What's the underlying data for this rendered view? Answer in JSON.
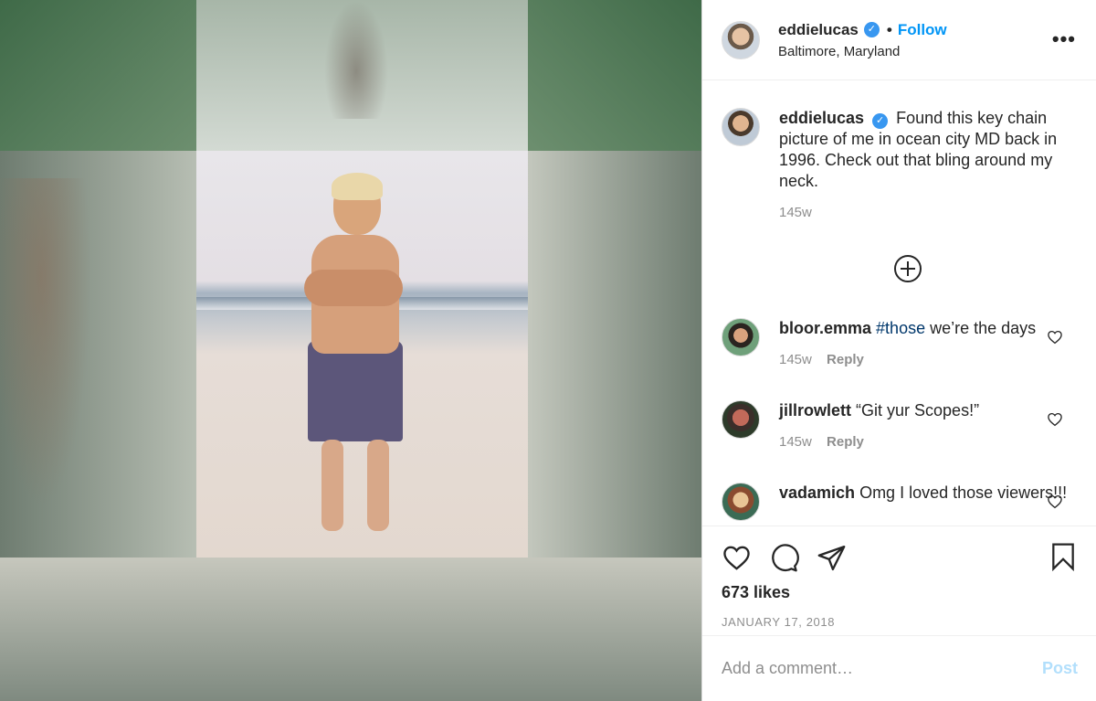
{
  "post": {
    "username": "eddielucas",
    "verified_icon": "verified-badge-icon",
    "separator": "•",
    "follow_label": "Follow",
    "location": "Baltimore, Maryland",
    "more_icon": "more-options-icon",
    "more_label": "•••"
  },
  "caption": {
    "username": "eddielucas",
    "text": "Found this key chain picture of me in ocean city MD back in 1996. Check out that bling around my neck.",
    "time": "145w"
  },
  "load_more_icon": "plus-circle-icon",
  "comments": [
    {
      "username": "bloor.emma",
      "hashtag": "#those",
      "text": " we’re the days",
      "time": "145w",
      "reply_label": "Reply"
    },
    {
      "username": "jillrowlett",
      "text": "“Git yur Scopes!”",
      "time": "145w",
      "reply_label": "Reply"
    },
    {
      "username": "vadamich",
      "text": "Omg I loved those viewers!!!",
      "time": "",
      "reply_label": ""
    }
  ],
  "actions": {
    "like_icon": "heart-icon",
    "comment_icon": "comment-icon",
    "share_icon": "share-icon",
    "save_icon": "bookmark-icon",
    "likes": "673 likes",
    "date": "JANUARY 17, 2018"
  },
  "add_comment": {
    "placeholder": "Add a comment…",
    "post_label": "Post"
  },
  "colors": {
    "accent": "#0095f6",
    "post_disabled": "#b2dffc",
    "verified": "#3897f0"
  }
}
